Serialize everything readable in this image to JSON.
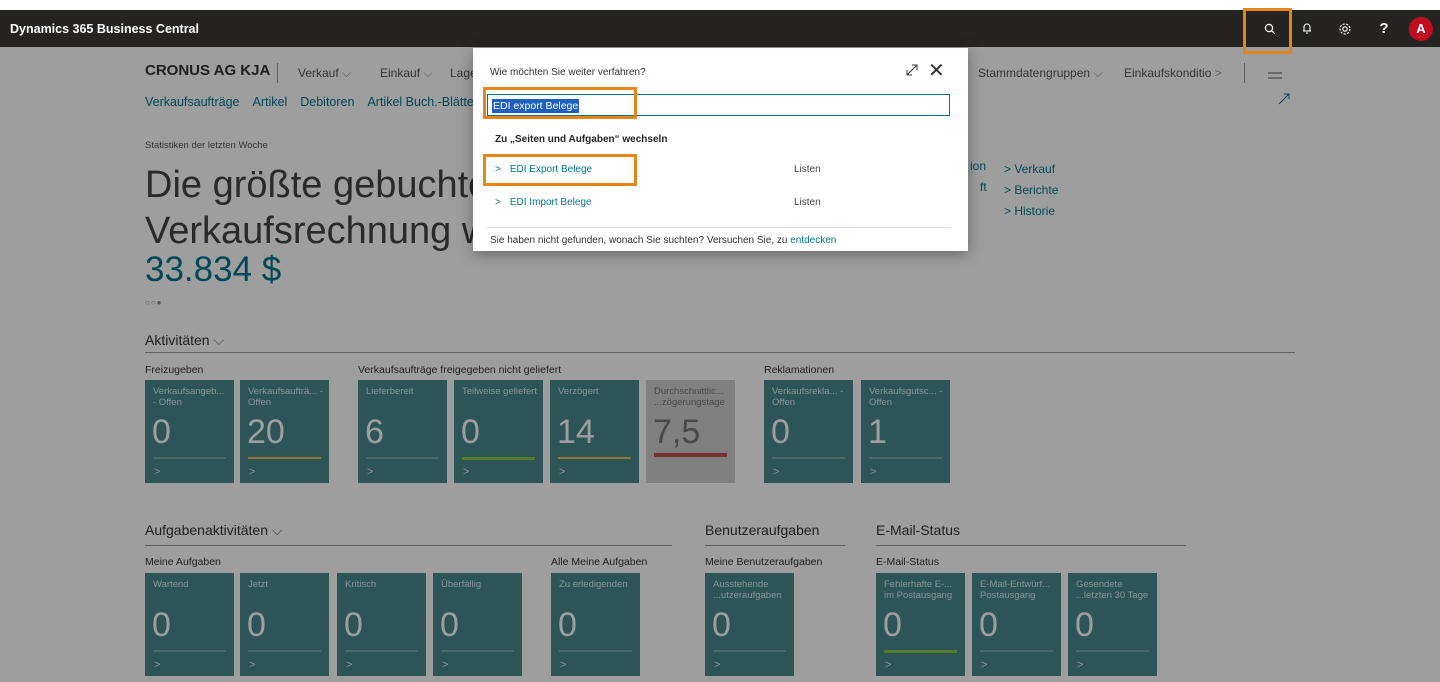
{
  "topbar": {
    "app_title": "Dynamics 365 Business Central",
    "avatar_letter": "A",
    "help_label": "?"
  },
  "nav": {
    "company": "CRONUS AG KJA",
    "menu": [
      "Verkauf",
      "Einkauf",
      "Lage"
    ],
    "menu_right": [
      "Stammdatengruppen",
      "Einkaufskonditio"
    ],
    "links": [
      "Verkaufsaufträge",
      "Artikel",
      "Debitoren",
      "Artikel Buch.-Blätte"
    ]
  },
  "stats": {
    "label": "Statistiken der letzten Woche",
    "headline_line1": "Die größte gebuchte",
    "headline_line2": "Verkaufsrechnung wa",
    "value": "33.834 $",
    "dots": "○○●"
  },
  "side_links": {
    "partial1": "ion",
    "partial2": "ft",
    "items": [
      "> Verkauf",
      "> Berichte",
      "> Historie"
    ]
  },
  "activities": {
    "title": "Aktivitäten",
    "groups": [
      {
        "label": "Freizugeben",
        "tiles": [
          {
            "label": "Verkaufsangeb... - Offen",
            "value": "0"
          },
          {
            "label": "Verkaufsaufträ... - Offen",
            "value": "20"
          }
        ]
      },
      {
        "label": "Verkaufsaufträge freigegeben nicht geliefert",
        "tiles": [
          {
            "label": "Lieferbereit",
            "value": "6"
          },
          {
            "label": "Teilweise geliefert",
            "value": "0"
          },
          {
            "label": "Verzögert",
            "value": "14"
          },
          {
            "label": "Durchschnittlic... ...zögerungstage",
            "value": "7,5"
          }
        ]
      },
      {
        "label": "Reklamationen",
        "tiles": [
          {
            "label": "Verkaufsrekla... - Offen",
            "value": "0"
          },
          {
            "label": "Verkaufsgutsc... - Offen",
            "value": "1"
          }
        ]
      }
    ]
  },
  "task_activities": {
    "title": "Aufgabenaktivitäten",
    "group1_label": "Meine Aufgaben",
    "tiles": [
      {
        "label": "Wartend",
        "value": "0"
      },
      {
        "label": "Jetzt",
        "value": "0"
      },
      {
        "label": "Kritisch",
        "value": "0"
      },
      {
        "label": "Überfällig",
        "value": "0"
      }
    ],
    "group2_label": "Alle Meine Aufgaben",
    "tiles2": [
      {
        "label": "Zu erledigenden",
        "value": "0"
      }
    ]
  },
  "user_tasks": {
    "title": "Benutzeraufgaben",
    "group_label": "Meine Benutzeraufgaben",
    "tiles": [
      {
        "label": "Ausstehende ...utzeraufgaben",
        "value": "0"
      }
    ]
  },
  "email": {
    "title": "E-Mail-Status",
    "group_label": "E-Mail-Status",
    "tiles": [
      {
        "label": "Fehlerhafte E-... im Postausgang",
        "value": "0"
      },
      {
        "label": "E-Mail-Entwürf... Postausgang",
        "value": "0"
      },
      {
        "label": "Gesendete ...letzten 30 Tage",
        "value": "0"
      }
    ]
  },
  "dialog": {
    "title": "Wie möchten Sie weiter verfahren?",
    "search_value": "EDI export Belege",
    "section": "Zu „Seiten und Aufgaben“ wechseln",
    "results": [
      {
        "label": "EDI Export Belege",
        "type": "Listen"
      },
      {
        "label": "EDI Import Belege",
        "type": "Listen"
      }
    ],
    "footer_text": "Sie haben nicht gefunden, wonach Sie suchten? Versuchen Sie, zu",
    "footer_link": "entdecken"
  },
  "colors": {
    "tile": "#4a8a8d",
    "accent": "#00758f",
    "highlight": "#e8851a",
    "green": "#8cc34a",
    "yellow": "#e8c25a",
    "red": "#c0504d"
  },
  "icons": [
    "search-icon",
    "bell-icon",
    "gear-icon",
    "help-icon",
    "expand-icon",
    "close-icon",
    "chevron-right-icon",
    "hamburger-icon"
  ]
}
